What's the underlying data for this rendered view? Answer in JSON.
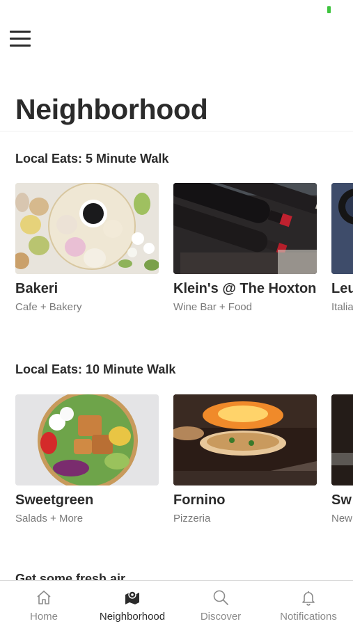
{
  "header": {
    "menu_icon": "hamburger-menu-icon",
    "title": "Neighborhood"
  },
  "sections": [
    {
      "title": "Local Eats: 5 Minute Walk",
      "cards": [
        {
          "name": "Bakeri",
          "subtitle": "Cafe + Bakery",
          "image": "macarons-and-coffee"
        },
        {
          "name": "Klein's @ The Hoxton",
          "subtitle": "Wine Bar + Food",
          "image": "wine-bottles"
        },
        {
          "name": "Leu",
          "subtitle": "Italia",
          "image": "cast-iron-pot"
        }
      ]
    },
    {
      "title": "Local Eats: 10 Minute Walk",
      "cards": [
        {
          "name": "Sweetgreen",
          "subtitle": "Salads + More",
          "image": "salad-bowl"
        },
        {
          "name": "Fornino",
          "subtitle": "Pizzeria",
          "image": "wood-fired-pizza"
        },
        {
          "name": "Sw",
          "subtitle": "New",
          "image": "dark-dish"
        }
      ]
    }
  ],
  "peek_section": {
    "title": "Get some fresh air"
  },
  "tab_bar": {
    "active": "Neighborhood",
    "tabs": [
      {
        "label": "Home",
        "icon": "home-icon"
      },
      {
        "label": "Neighborhood",
        "icon": "map-pin-icon"
      },
      {
        "label": "Discover",
        "icon": "search-icon"
      },
      {
        "label": "Notifications",
        "icon": "bell-icon"
      }
    ]
  },
  "colors": {
    "text_primary": "#2b2b2b",
    "text_secondary": "#7a7a7a",
    "tab_inactive": "#8b8b8b",
    "battery": "#3ec43e"
  }
}
